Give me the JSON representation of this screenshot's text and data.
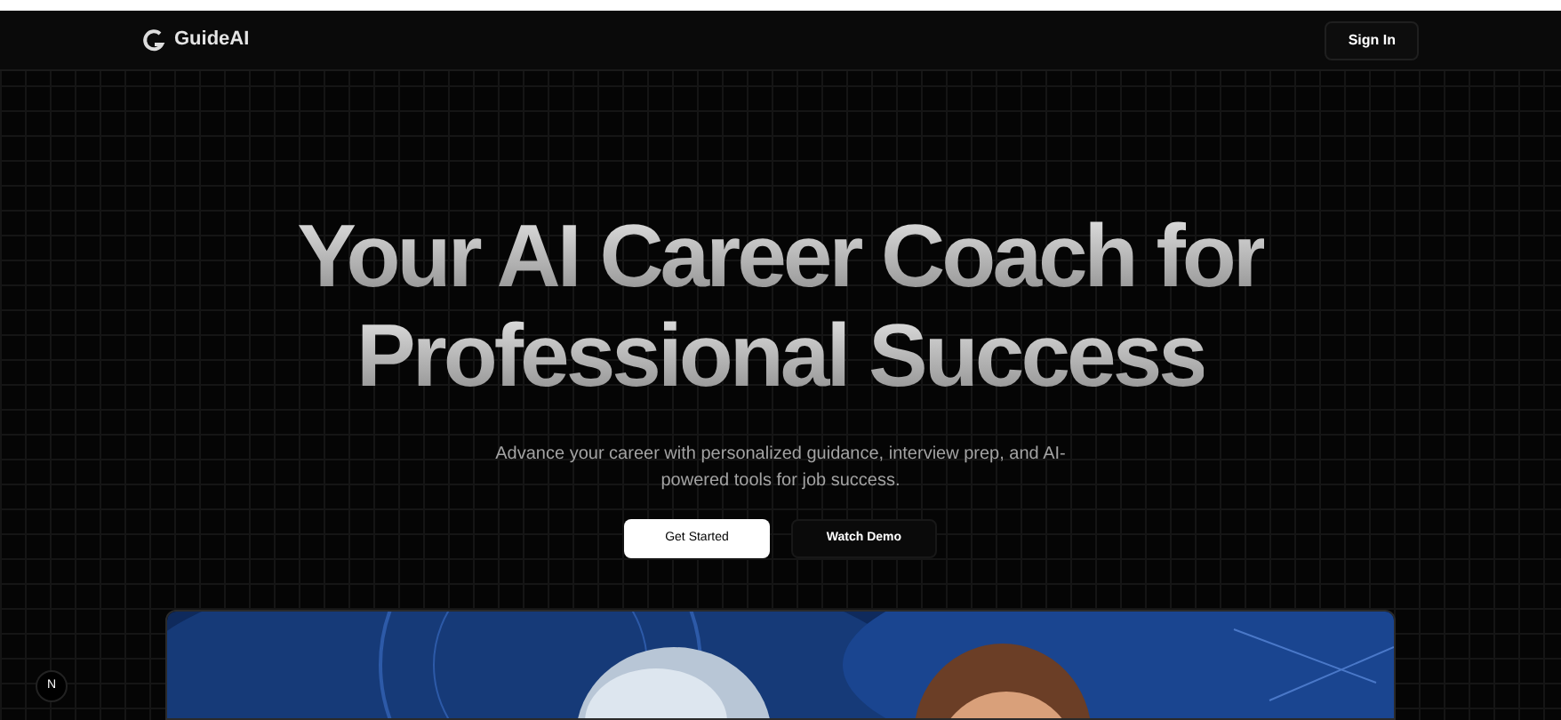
{
  "header": {
    "brand": "GuideAI",
    "sign_in": "Sign In"
  },
  "hero": {
    "title_lines": [
      "Your AI Career Coach for",
      "Professional Success"
    ],
    "subtitle": "Advance your career with personalized guidance, interview prep, and AI-powered tools for job success.",
    "buttons": [
      {
        "label": "Get Started",
        "kind": "primary"
      },
      {
        "label": "Watch Demo",
        "kind": "ghost"
      }
    ]
  },
  "dev_badge": "N"
}
